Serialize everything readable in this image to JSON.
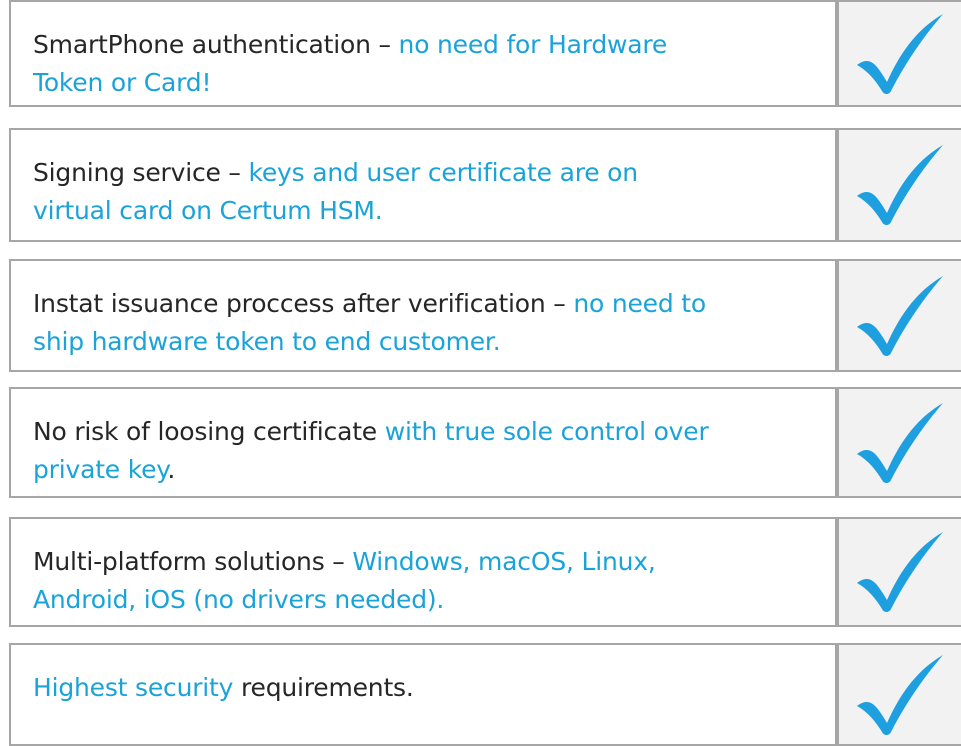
{
  "features": [
    {
      "parts": [
        {
          "text": "SmartPhone authentication – ",
          "highlight": false
        },
        {
          "text": "no need for Hardware",
          "highlight": true
        },
        {
          "br": true
        },
        {
          "text": "Token or Card!",
          "highlight": true
        }
      ]
    },
    {
      "parts": [
        {
          "text": "Signing service – ",
          "highlight": false
        },
        {
          "text": "keys and user certificate are on",
          "highlight": true
        },
        {
          "br": true
        },
        {
          "text": "virtual card on Certum HSM.",
          "highlight": true
        }
      ]
    },
    {
      "parts": [
        {
          "text": "Instat issuance proccess after verification – ",
          "highlight": false
        },
        {
          "text": "no need to",
          "highlight": true
        },
        {
          "br": true
        },
        {
          "text": "ship hardware token to end customer.",
          "highlight": true
        }
      ]
    },
    {
      "parts": [
        {
          "text": "No risk of loosing certificate ",
          "highlight": false
        },
        {
          "text": "with true sole control over",
          "highlight": true
        },
        {
          "br": true
        },
        {
          "text": "private key",
          "highlight": true
        },
        {
          "text": ".",
          "highlight": false
        }
      ]
    },
    {
      "parts": [
        {
          "text": "Multi-platform solutions – ",
          "highlight": false
        },
        {
          "text": "Windows, macOS, Linux,",
          "highlight": true
        },
        {
          "br": true
        },
        {
          "text": "Android, iOS (no drivers needed).",
          "highlight": true
        }
      ]
    },
    {
      "parts": [
        {
          "text": "Highest security",
          "highlight": true
        },
        {
          "text": " requirements.",
          "highlight": false
        }
      ]
    }
  ],
  "icon": "checkmark-icon",
  "colors": {
    "text": "#262626",
    "highlight": "#1aa3d9",
    "check": "#1e9fe0",
    "border": "#a6a6a6",
    "check_cell_bg": "#f2f2f2"
  }
}
